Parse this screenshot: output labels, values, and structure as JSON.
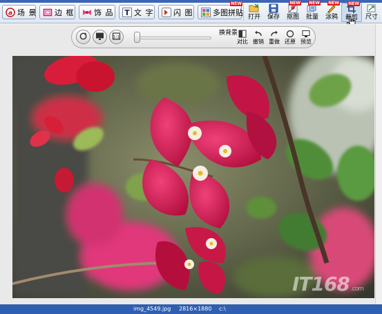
{
  "toolbar": {
    "buttons": [
      {
        "label": "场 景",
        "icon": "scene-icon"
      },
      {
        "label": "边 框",
        "icon": "frame-icon"
      },
      {
        "label": "饰 品",
        "icon": "decoration-icon"
      },
      {
        "label": "文 字",
        "icon": "text-icon"
      },
      {
        "label": "闪 图",
        "icon": "flash-icon"
      },
      {
        "label": "多图拼贴",
        "icon": "collage-icon"
      }
    ],
    "badge_new": "NEW",
    "small_buttons": [
      {
        "label": "打开",
        "icon": "open-folder-icon"
      },
      {
        "label": "保存",
        "icon": "save-icon"
      },
      {
        "label": "抠图",
        "icon": "cutout-icon"
      },
      {
        "label": "批量",
        "icon": "batch-icon"
      },
      {
        "label": "涂鸦",
        "icon": "doodle-icon"
      },
      {
        "label": "裁剪",
        "icon": "crop-icon"
      },
      {
        "label": "尺寸",
        "icon": "resize-icon"
      }
    ]
  },
  "view_bar": {
    "buttons": [
      {
        "label": "换背景",
        "icon": "background-icon"
      },
      {
        "label": "对比",
        "icon": "compare-icon"
      },
      {
        "label": "撤销",
        "icon": "undo-icon"
      },
      {
        "label": "重做",
        "icon": "redo-icon"
      },
      {
        "label": "还原",
        "icon": "restore-icon"
      },
      {
        "label": "预览",
        "icon": "preview-icon"
      }
    ],
    "zoom_fraction": 0.0
  },
  "watermark": {
    "text": "IT168",
    "suffix": ".com"
  },
  "status": {
    "filename": "img_4549.jpg",
    "dimensions": "2816×1880",
    "path": "c:\\"
  },
  "colors": {
    "accent": "#3c66b5",
    "status_bar": "#2f5fb0",
    "badge": "#e0141b"
  }
}
